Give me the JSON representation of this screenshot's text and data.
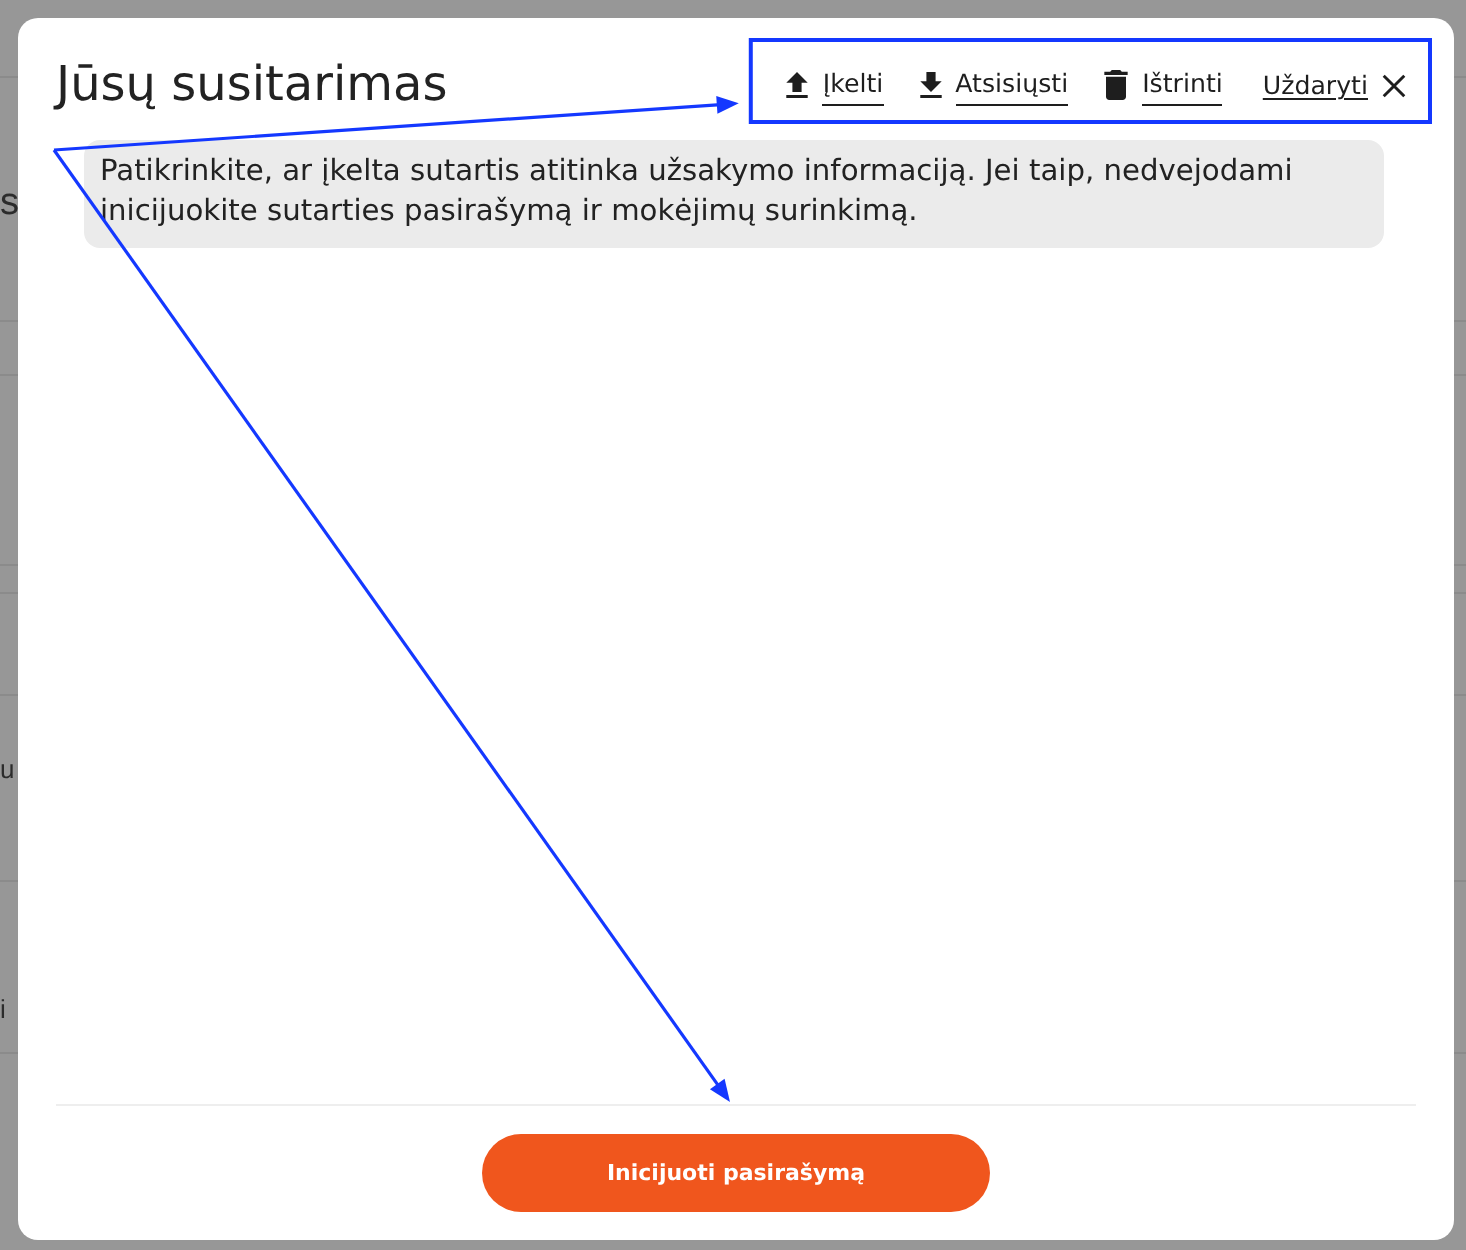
{
  "background_page": {
    "fragments": [
      "s",
      "u",
      "i"
    ]
  },
  "dialog": {
    "title": "Jūsų susitarimas",
    "toolbar": {
      "highlighted": true,
      "pointed_at": true,
      "items": [
        {
          "kind": "upload",
          "label": "Įkelti"
        },
        {
          "kind": "download",
          "label": "Atsisiųsti"
        },
        {
          "kind": "delete",
          "label": "Ištrinti"
        },
        {
          "kind": "close",
          "label": "Uždaryti"
        }
      ]
    },
    "notice": "Patikrinkite, ar įkelta sutartis atitinka užsakymo informaciją. Jei taip, nedvejodami inicijuokite sutarties pasirašymą ir mokėjimų surinkimą.",
    "primary_button": {
      "label": "Inicijuoti pasirašymą",
      "pointed_at": true
    }
  }
}
